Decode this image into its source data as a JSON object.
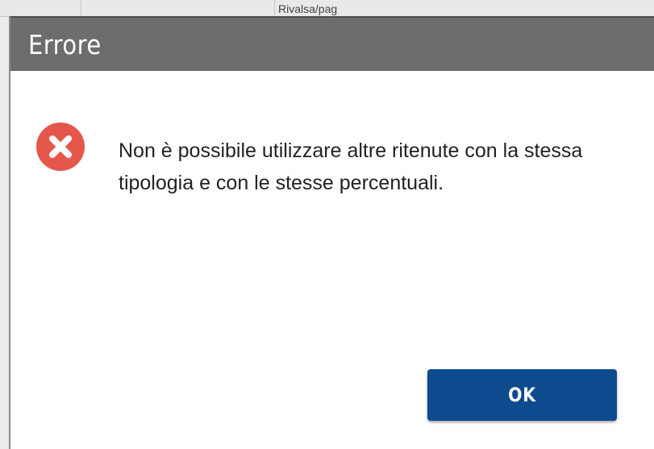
{
  "background": {
    "partial_text": "Rivalsa/pag"
  },
  "dialog": {
    "title": "Errore",
    "icon": "error-circle-x-icon",
    "message": "Non è possibile utilizzare altre ritenute con la stessa tipologia e con le stesse percentuali.",
    "ok_label": "OK"
  },
  "colors": {
    "titlebar": "#6d6d6d",
    "error_icon": "#e5574b",
    "button": "#0e4a8e",
    "text": "#222222"
  }
}
